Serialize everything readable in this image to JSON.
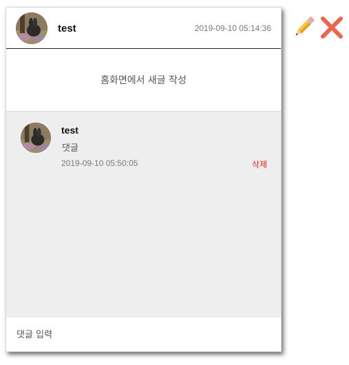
{
  "post": {
    "username": "test",
    "timestamp": "2019-09-10 05:14:36",
    "content": "홈화면에서 새글 작성",
    "avatar_icon": "profile-photo"
  },
  "comments": [
    {
      "username": "test",
      "text": "댓글",
      "timestamp": "2019-09-10 05:50:05",
      "delete_label": "삭제"
    }
  ],
  "comment_input": {
    "placeholder": "댓글 입력",
    "value": ""
  },
  "actions": {
    "edit_icon": "pencil-icon",
    "delete_icon": "close-icon"
  },
  "colors": {
    "delete_link": "#e02020",
    "comments_bg": "#eeeeee",
    "close_icon": "#e8664f",
    "pencil_body": "#f5b731"
  }
}
